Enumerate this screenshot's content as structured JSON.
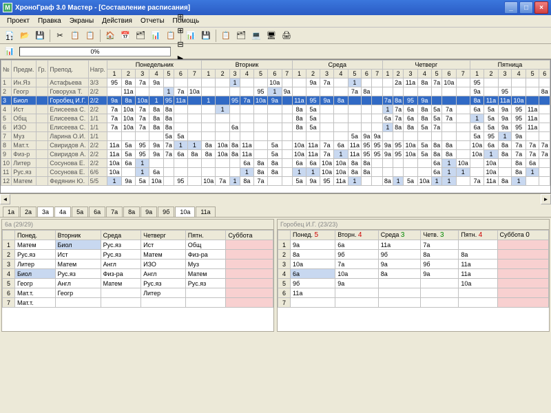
{
  "window": {
    "icon": "М",
    "title": "ХроноГраф 3.0 Мастер - [Составление расписания]"
  },
  "menu": [
    "Проект",
    "Правка",
    "Экраны",
    "Действия",
    "Отчеты",
    "Помощь"
  ],
  "toolbar_icons": [
    "📄",
    "📂",
    "💾",
    "✂",
    "📋",
    "📋",
    "🏠",
    "📅",
    "🗂",
    "📊",
    "📋",
    "📊",
    "💾",
    "📋",
    "🗂",
    "💻",
    "🖥",
    "🖨"
  ],
  "toolbar2": {
    "icons_left": [
      "1↕",
      "📊",
      "↔"
    ],
    "progress": "0%",
    "icons_right": [
      "⊞",
      "⊞",
      "⊟",
      "▶",
      "⬚",
      "⊡"
    ]
  },
  "main_headers": {
    "fixed": [
      "№",
      "Предм.",
      "Гр.",
      "Препод.",
      "Нагр."
    ],
    "days": [
      "Понедельник",
      "Вторник",
      "Среда",
      "Четверг",
      "Пятница"
    ],
    "periods": [
      7,
      7,
      7,
      7,
      6
    ]
  },
  "rows": [
    {
      "n": "1",
      "subj": "Ин.Яз",
      "teach": "Астафьева",
      "load": "3/3",
      "cells": [
        "95",
        "8а",
        "7а",
        "9а",
        "",
        "",
        "",
        "",
        "",
        "1",
        "",
        "",
        "10а",
        "",
        "",
        "9а",
        "7а",
        "",
        "1",
        "",
        "",
        "",
        "2а",
        "11а",
        "8а",
        "7а",
        "10а",
        "",
        "95",
        "",
        "",
        "",
        "",
        ""
      ]
    },
    {
      "n": "2",
      "subj": "Геогр",
      "teach": "Говоруха Т.",
      "load": "2/2",
      "cells": [
        "",
        "11а",
        "",
        "",
        "1",
        "7а",
        "10а",
        "",
        "",
        "",
        "",
        "95",
        "1",
        "9а",
        "",
        "",
        "",
        "",
        "7а",
        "8а",
        "",
        "",
        "",
        "",
        "",
        "",
        "",
        "",
        "9а",
        "",
        "95",
        "",
        "",
        "8а"
      ]
    },
    {
      "n": "3",
      "subj": "Биол",
      "teach": "Горобец И.Г.",
      "load": "2/2",
      "sel": true,
      "cells": [
        "9а",
        "8а",
        "10а",
        "1",
        "95",
        "11а",
        "",
        "1",
        "",
        "95",
        "7а",
        "10а",
        "9а",
        "",
        "11а",
        "95",
        "9а",
        "8а",
        "",
        "",
        "",
        "7а",
        "8а",
        "95",
        "9а",
        "",
        "",
        "",
        "8а",
        "11а",
        "11а",
        "10а",
        "",
        ""
      ]
    },
    {
      "n": "4",
      "subj": "Ист",
      "teach": "Елисеева С.",
      "load": "2/2",
      "cells": [
        "7а",
        "10а",
        "7а",
        "8а",
        "8а",
        "",
        "",
        "",
        "1",
        "",
        "",
        "",
        "",
        "",
        "8а",
        "5а",
        "",
        "",
        "",
        "",
        "",
        "1",
        "7а",
        "6а",
        "8а",
        "5а",
        "7а",
        "",
        "6а",
        "5а",
        "9а",
        "95",
        "11а",
        ""
      ]
    },
    {
      "n": "5",
      "subj": "Общ",
      "teach": "Елисеева С.",
      "load": "1/1",
      "cells": [
        "7а",
        "10а",
        "7а",
        "8а",
        "8а",
        "",
        "",
        "",
        "",
        "",
        "",
        "",
        "",
        "",
        "8а",
        "5а",
        "",
        "",
        "",
        "",
        "",
        "6а",
        "7а",
        "6а",
        "8а",
        "5а",
        "7а",
        "",
        "1",
        "5а",
        "9а",
        "95",
        "11а",
        ""
      ]
    },
    {
      "n": "6",
      "subj": "ИЗО",
      "teach": "Елисеева С.",
      "load": "1/1",
      "cells": [
        "7а",
        "10а",
        "7а",
        "8а",
        "8а",
        "",
        "",
        "",
        "",
        "6а",
        "",
        "",
        "",
        "",
        "8а",
        "5а",
        "",
        "",
        "",
        "",
        "",
        "1",
        "8а",
        "8а",
        "5а",
        "7а",
        "",
        "",
        "6а",
        "5а",
        "9а",
        "95",
        "11а",
        ""
      ]
    },
    {
      "n": "7",
      "subj": "Муз",
      "teach": "Ларина О.И.",
      "load": "1/1",
      "cells": [
        "",
        "",
        "",
        "",
        "5а",
        "5а",
        "",
        "",
        "",
        "",
        "",
        "",
        "",
        "",
        "",
        "",
        "",
        "",
        "5а",
        "9а",
        "9а",
        "",
        "",
        "",
        "",
        "",
        "",
        "",
        "5а",
        "95",
        "1",
        "9а",
        "",
        ""
      ]
    },
    {
      "n": "8",
      "subj": "Мат.т.",
      "teach": "Свиридов А.",
      "load": "2/2",
      "cells": [
        "11а",
        "5а",
        "95",
        "9а",
        "7а",
        "1",
        "1",
        "8а",
        "10а",
        "8а",
        "11а",
        "",
        "5а",
        "",
        "10а",
        "11а",
        "7а",
        "6а",
        "11а",
        "95",
        "95",
        "9а",
        "95",
        "10а",
        "5а",
        "8а",
        "8а",
        "",
        "10а",
        "6а",
        "8а",
        "7а",
        "7а",
        "7а"
      ]
    },
    {
      "n": "9",
      "subj": "Физ-р",
      "teach": "Свиридов А.",
      "load": "2/2",
      "cells": [
        "11а",
        "5а",
        "95",
        "9а",
        "7а",
        "6а",
        "8а",
        "8а",
        "10а",
        "8а",
        "11а",
        "",
        "5а",
        "",
        "10а",
        "11а",
        "7а",
        "1",
        "11а",
        "95",
        "95",
        "9а",
        "95",
        "10а",
        "5а",
        "8а",
        "8а",
        "",
        "10а",
        "1",
        "8а",
        "7а",
        "7а",
        "7а"
      ]
    },
    {
      "n": "10",
      "subj": "Литер",
      "teach": "Сосунова Е.",
      "load": "2/2",
      "cells": [
        "10а",
        "6а",
        "1",
        "",
        "",
        "",
        "",
        "",
        "",
        "",
        "6а",
        "8а",
        "8а",
        "",
        "6а",
        "6а",
        "10а",
        "10а",
        "8а",
        "8а",
        "",
        "",
        "",
        "",
        "",
        "6а",
        "1",
        "10а",
        "",
        "10а",
        "",
        "8а",
        "6а",
        ""
      ]
    },
    {
      "n": "11",
      "subj": "Рус.яз",
      "teach": "Сосунова Е.",
      "load": "6/6",
      "cells": [
        "10а",
        "",
        "1",
        "6а",
        "",
        "",
        "",
        "",
        "",
        "",
        "1",
        "8а",
        "8а",
        "",
        "1",
        "1",
        "10а",
        "10а",
        "8а",
        "8а",
        "",
        "",
        "",
        "",
        "",
        "6а",
        "1",
        "1",
        "",
        "10а",
        "",
        "8а",
        "1",
        ""
      ]
    },
    {
      "n": "12",
      "subj": "Матем",
      "teach": "Федянин Ю.",
      "load": "5/5",
      "cells": [
        "1",
        "9а",
        "5а",
        "10а",
        "",
        "95",
        "",
        "10а",
        "7а",
        "1",
        "8а",
        "7а",
        "",
        "",
        "5а",
        "9а",
        "95",
        "11а",
        "1",
        "",
        "",
        "8а",
        "1",
        "5а",
        "10а",
        "1",
        "1",
        "",
        "7а",
        "11а",
        "8а",
        "1",
        "",
        ""
      ]
    }
  ],
  "class_tabs": [
    "1а",
    "2а",
    "3а",
    "4а",
    "5а",
    "6а",
    "7а",
    "8а",
    "9а",
    "9б",
    "10а",
    "11а"
  ],
  "active_tabs": [
    "3а",
    "4а",
    "10а"
  ],
  "left_panel": {
    "title": "6а (29/29)",
    "headers": [
      "Понед.",
      "Вторник",
      "Среда",
      "Четверг",
      "Пятн.",
      "Суббота"
    ],
    "rows": [
      [
        "Матем",
        "Биол",
        "Рус.яз",
        "Ист",
        "Общ",
        ""
      ],
      [
        "Рус.яз",
        "Ист",
        "Рус.яз",
        "Матем",
        "Физ-ра",
        ""
      ],
      [
        "Литер",
        "Матем",
        "Англ",
        "ИЗО",
        "Муз",
        ""
      ],
      [
        "Биол",
        "Рус.яз",
        "Физ-ра",
        "Англ",
        "Матем",
        ""
      ],
      [
        "Геогр",
        "Англ",
        "Матем",
        "Рус.яз",
        "Рус.яз",
        ""
      ],
      [
        "Мат.т.",
        "Геогр",
        "",
        "Литер",
        "",
        ""
      ],
      [
        "Мат.т.",
        "",
        "",
        "",
        "",
        ""
      ]
    ]
  },
  "right_panel": {
    "title": "Горобец И.Г. (23/23)",
    "headers": [
      {
        "t": "Понед.",
        "n": "5",
        "c": "red"
      },
      {
        "t": "Вторн.",
        "n": "4",
        "c": "red"
      },
      {
        "t": "Среда",
        "n": "3",
        "c": "green"
      },
      {
        "t": "Четв.",
        "n": "3",
        "c": "green"
      },
      {
        "t": "Пятн.",
        "n": "4",
        "c": "red"
      },
      {
        "t": "Суббота",
        "n": "0",
        "c": ""
      }
    ],
    "rows": [
      [
        "9а",
        "6а",
        "11а",
        "7а",
        "",
        ""
      ],
      [
        "8а",
        "9б",
        "9б",
        "8а",
        "8а",
        ""
      ],
      [
        "10а",
        "7а",
        "9а",
        "9б",
        "11а",
        ""
      ],
      [
        "6а",
        "10а",
        "8а",
        "9а",
        "11а",
        ""
      ],
      [
        "9б",
        "9а",
        "",
        "",
        "10а",
        ""
      ],
      [
        "11а",
        "",
        "",
        "",
        "",
        ""
      ],
      [
        "",
        "",
        "",
        "",
        "",
        ""
      ]
    ]
  }
}
